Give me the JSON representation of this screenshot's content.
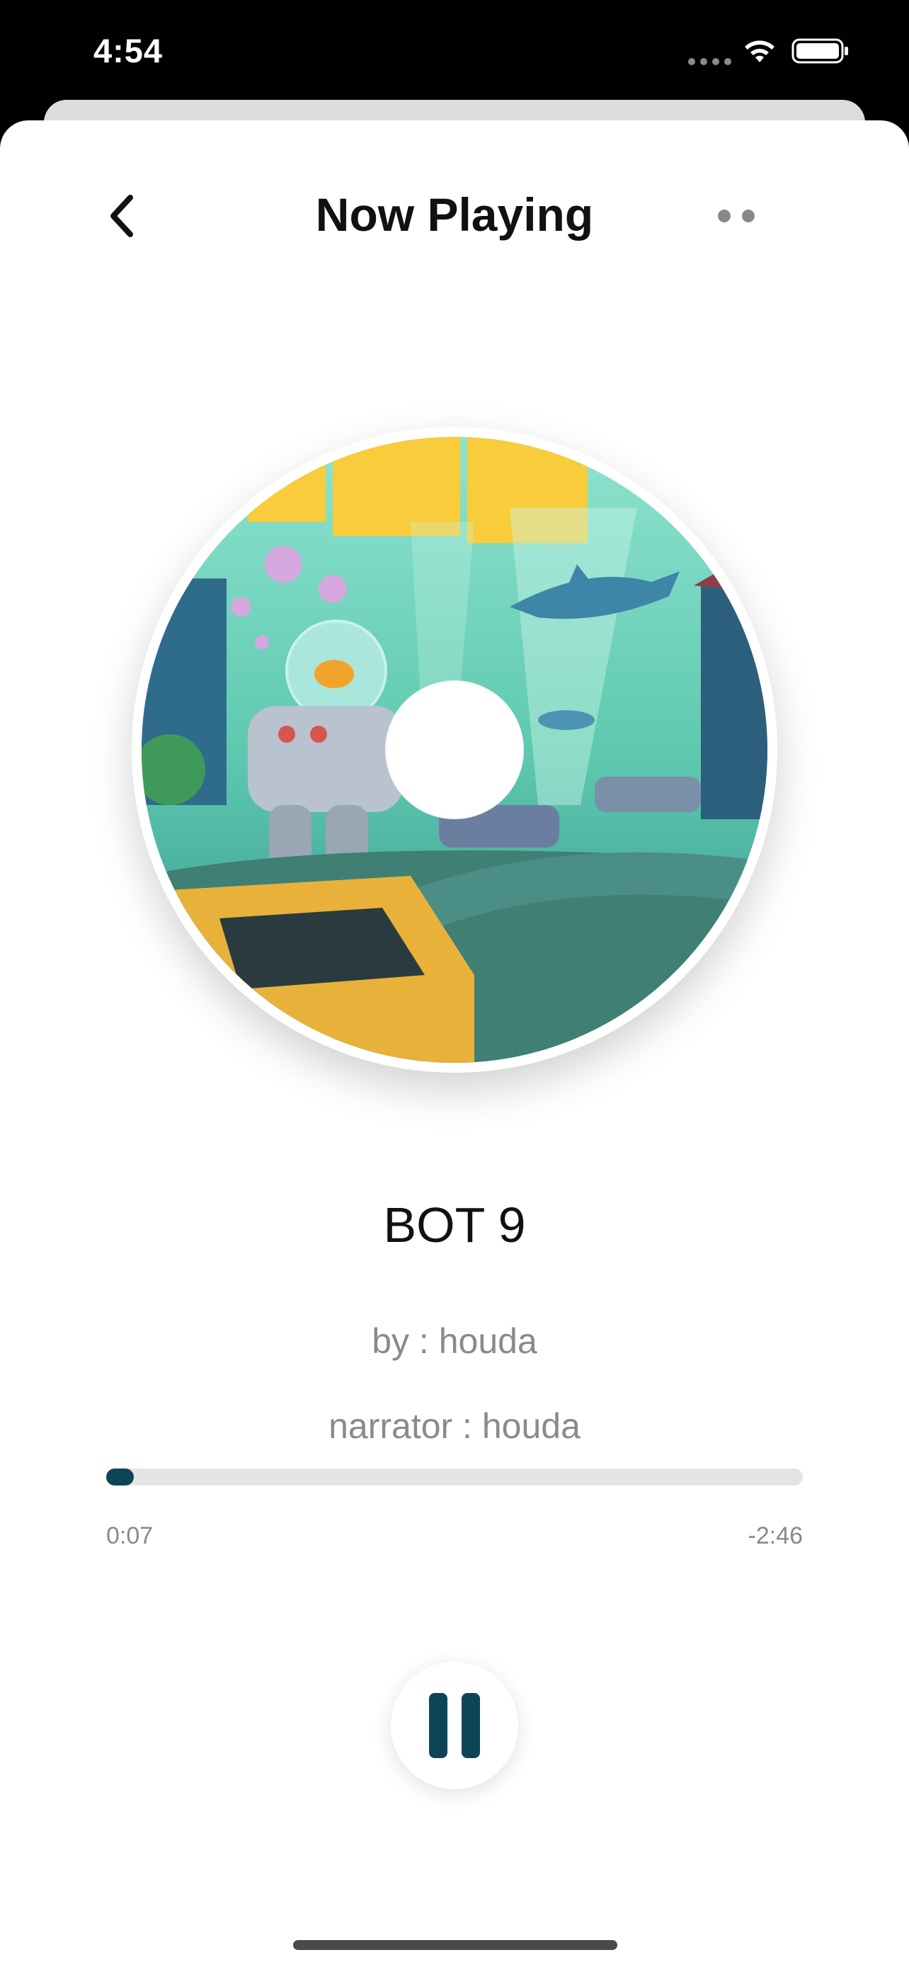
{
  "status_bar": {
    "time": "4:54"
  },
  "header": {
    "title": "Now Playing"
  },
  "track": {
    "title": "BOT 9",
    "author": "by : houda",
    "narrator": "narrator : houda"
  },
  "progress": {
    "elapsed": "0:07",
    "remaining": "-2:46",
    "fraction": 0.04
  },
  "colors": {
    "accent": "#0e4556",
    "track_bg": "#e4e4e4",
    "secondary_text": "#8a8a8a"
  },
  "icons": {
    "back": "chevron-left-icon",
    "more": "more-dots-icon",
    "play_state": "pause-icon"
  }
}
